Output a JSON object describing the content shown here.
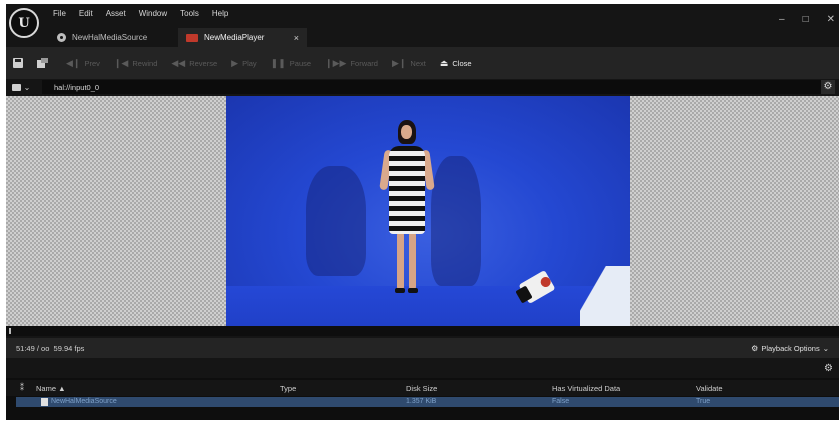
{
  "app": {
    "logo_text": "U",
    "menu": [
      "File",
      "Edit",
      "Asset",
      "Window",
      "Tools",
      "Help"
    ],
    "window_controls": [
      "–",
      "□",
      "✕"
    ]
  },
  "tabs": [
    {
      "label": "NewHalMediaSource",
      "icon": "media-source-icon",
      "active": false
    },
    {
      "label": "NewMediaPlayer",
      "icon": "media-player-icon",
      "active": true,
      "close": "×"
    }
  ],
  "toolbar": {
    "buttons": [
      {
        "label": "Prev",
        "glyph": "◀❙",
        "enabled": false
      },
      {
        "label": "Rewind",
        "glyph": "❙◀",
        "enabled": false
      },
      {
        "label": "Reverse",
        "glyph": "◀◀",
        "enabled": false
      },
      {
        "label": "Play",
        "glyph": "▶",
        "enabled": false
      },
      {
        "label": "Pause",
        "glyph": "❚❚",
        "enabled": false
      },
      {
        "label": "Forward",
        "glyph": "❙▶▶",
        "enabled": false
      },
      {
        "label": "Next",
        "glyph": "▶❙",
        "enabled": false
      },
      {
        "label": "Close",
        "glyph": "⏏",
        "enabled": true
      }
    ]
  },
  "url_bar": {
    "value": "hal://input0_0",
    "dropdown_arrow": "⌄",
    "gear": "⚙"
  },
  "status": {
    "time": "51:49 / oo",
    "fps": "59.94 fps",
    "playback_options": "Playback Options",
    "playback_options_arrow": "⌄",
    "gear_small": "⚙"
  },
  "playlist": {
    "columns": [
      "Name",
      "Type",
      "Disk Size",
      "Has Virtualized Data",
      "Validate"
    ],
    "name_sort_indicator": "▲",
    "header_icon": "⁑",
    "gear": "⚙",
    "rows": [
      {
        "name": "NewHalMediaSource",
        "type": "",
        "disk_size": "1.357 KiB",
        "has_virtualized_data": "False",
        "validate": "True"
      }
    ]
  },
  "colors": {
    "accent_blue_row": "#2f4a6e",
    "video_blue": "#2448d2",
    "background": "#151515"
  }
}
